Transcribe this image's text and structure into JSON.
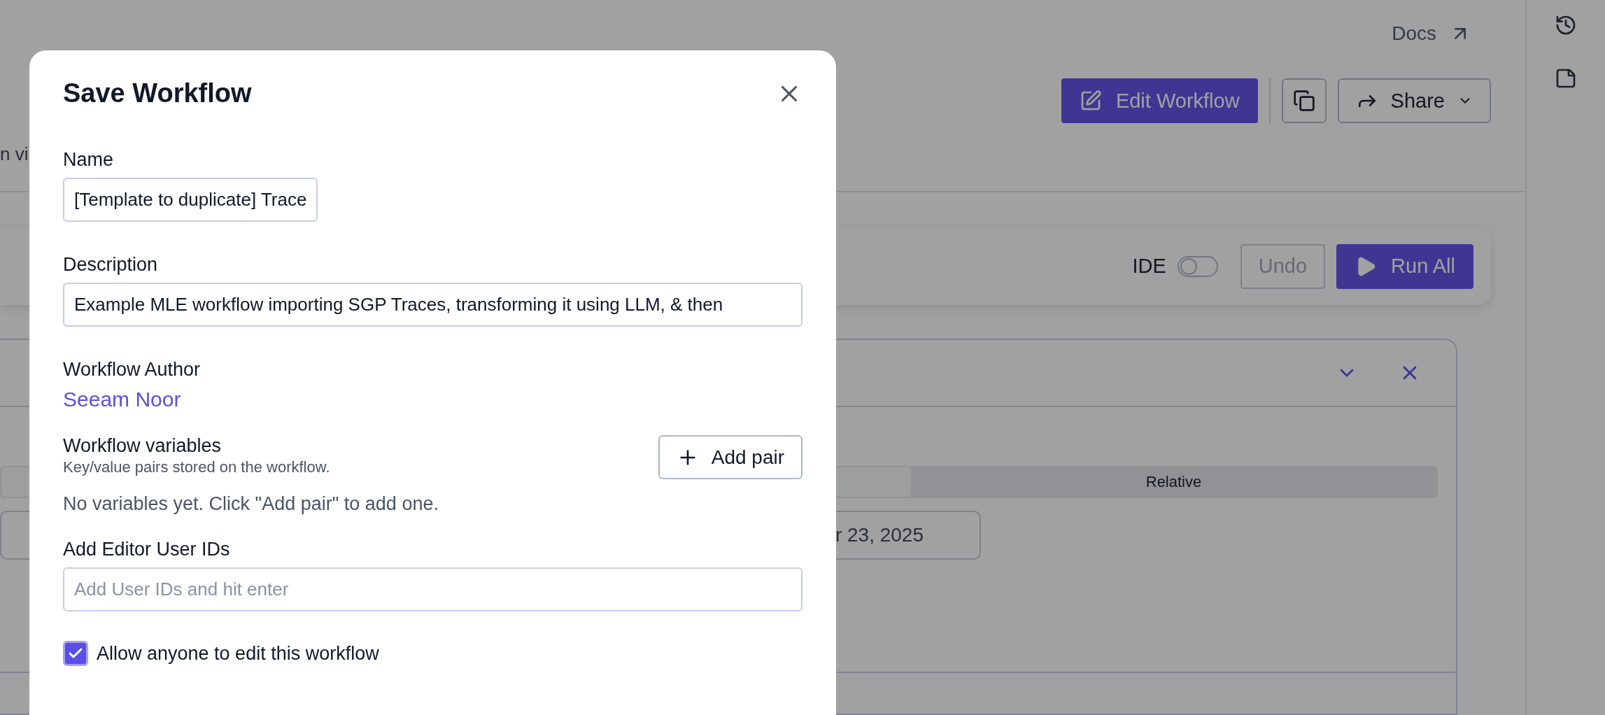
{
  "header": {
    "docs_link": "Docs",
    "description_fragment": "n vi",
    "edit_button": "Edit Workflow",
    "share_button": "Share"
  },
  "toolbar": {
    "ide_label": "IDE",
    "ide_on": false,
    "undo": "Undo",
    "undo_disabled": true,
    "run_all": "Run All"
  },
  "panel": {
    "tabs": [
      {
        "selected": true
      },
      {
        "label": "Relative",
        "selected": false
      }
    ],
    "date_value": "r 23, 2025"
  },
  "modal": {
    "title": "Save Workflow",
    "name_label": "Name",
    "name_value": "[Template to duplicate] Trace",
    "description_label": "Description",
    "description_value": "Example MLE workflow importing SGP Traces, transforming it using LLM, & then",
    "author_label": "Workflow Author",
    "author": "Seeam Noor",
    "variables_label": "Workflow variables",
    "variables_hint": "Key/value pairs stored on the workflow.",
    "add_pair": "Add pair",
    "variables_empty": "No variables yet. Click \"Add pair\" to add one.",
    "editors_label": "Add Editor User IDs",
    "editors_placeholder": "Add User IDs and hit enter",
    "allow_edit_label": "Allow anyone to edit this workflow",
    "allow_edit": true
  }
}
